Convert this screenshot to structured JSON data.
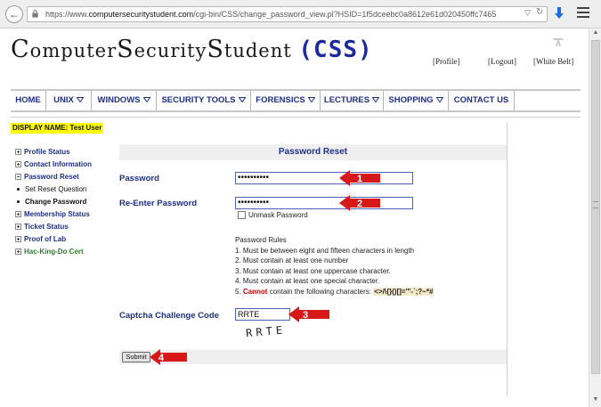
{
  "browser": {
    "url_prefix": "https://www.",
    "url_host": "computersecuritystudent.com",
    "url_path": "/cgi-bin/CSS/change_password_view.pl?HSID=1f5dceebc0a8612e61d020450ffc7465"
  },
  "header": {
    "title": {
      "c1": "C",
      "r1": "omputer",
      "c2": "S",
      "r2": "ecurity",
      "c3": "S",
      "r3": "tudent",
      "abbr": "(CSS)"
    },
    "links": {
      "profile": "[Profile]",
      "logout": "[Logout]",
      "belt": "[White Belt]"
    }
  },
  "nav": [
    "HOME",
    "UNIX",
    "WINDOWS",
    "SECURITY TOOLS",
    "FORENSICS",
    "LECTURES",
    "SHOPPING",
    "CONTACT US"
  ],
  "sidebar": {
    "display_name": "DISPLAY NAME: Test User",
    "items": [
      "Profile Status",
      "Contact Information",
      "Password Reset"
    ],
    "subitems": [
      "Set Reset Question",
      "Change Password"
    ],
    "items2": [
      "Membership Status",
      "Ticket Status",
      "Proof of Lab",
      "Hac-King-Do Cert"
    ]
  },
  "form": {
    "title": "Password Reset",
    "password_label": "Password",
    "password_value": "••••••••••",
    "reenter_label": "Re-Enter Password",
    "reenter_value": "••••••••••",
    "unmask_label": "Unmask Password",
    "rules_title": "Password Rules",
    "rules": [
      "1. Must be between eight and fifteen characters in length",
      "2. Must contain at least one number",
      "3. Must contain at least one uppercase character.",
      "4. Must contain at least one special character."
    ],
    "rule5_num": "5.",
    "rule5_cannot": "Cannot",
    "rule5_text": "contain the following characters:",
    "rule5_chars": "<>/\\{}()[]='\"-`;?~*#",
    "captcha_label": "Captcha Challenge Code",
    "captcha_value": "RRTE",
    "captcha_image_text": "RRTE",
    "submit_label": "Submit"
  },
  "annotations": [
    "1",
    "2",
    "3",
    "4"
  ],
  "colors": {
    "nav_text": "#1e2f86",
    "arrow_red": "#d81818",
    "highlight_yellow": "#ffff00",
    "brand_blue": "#1c2aa0"
  },
  "icons": [
    "back-arrow-icon",
    "lock-icon",
    "reload-icon",
    "download-icon",
    "hamburger-menu-icon",
    "white-belt-icon"
  ]
}
